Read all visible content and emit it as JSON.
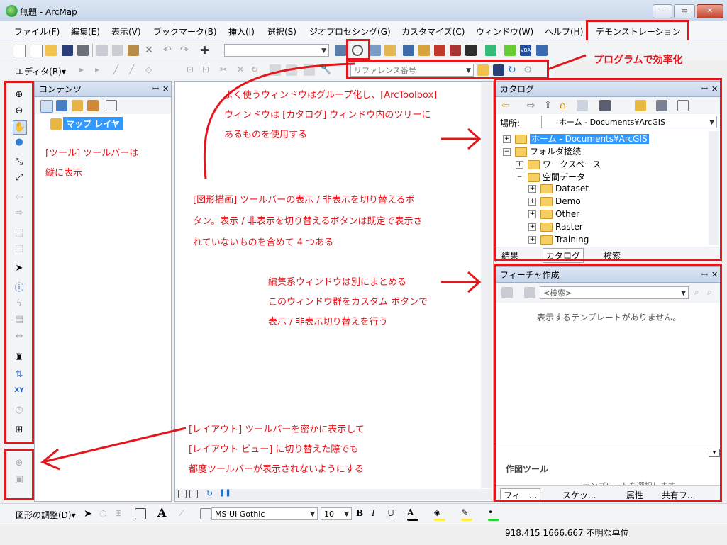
{
  "window": {
    "title": "無題 - ArcMap"
  },
  "menu": [
    "ファイル(F)",
    "編集(E)",
    "表示(V)",
    "ブックマーク(B)",
    "挿入(I)",
    "選択(S)",
    "ジオプロセシング(G)",
    "カスタマイズ(C)",
    "ウィンドウ(W)",
    "ヘルプ(H)",
    "デモンストレーション"
  ],
  "editor_toolbar": {
    "label": "エディタ(R)▾",
    "reference_combo": "リファレンス番号"
  },
  "toc": {
    "title": "コンテンツ",
    "layer": "マップ レイヤ"
  },
  "catalog": {
    "title": "カタログ",
    "location_label": "場所:",
    "location_value": "ホーム - Documents¥ArcGIS",
    "tree": {
      "home": "ホーム - Documents¥ArcGIS",
      "folder_connections": "フォルダ接続",
      "workspace": "ワークスペース",
      "spatial_data": "空間データ",
      "items": [
        "Dataset",
        "Demo",
        "Other",
        "Raster",
        "Training"
      ]
    },
    "tabs": [
      "結果",
      "カタログ",
      "検索"
    ]
  },
  "create_features": {
    "title": "フィーチャ作成",
    "search_placeholder": "<検索>",
    "empty_message": "表示するテンプレートがありません。",
    "construction_tools": "作図ツール",
    "hint_partial": "テンプレートを選択します",
    "tabs": [
      "フィー...",
      "スケッ...",
      "属性",
      "共有フ..."
    ]
  },
  "drawing_toolbar": {
    "label": "図形の調整(D)▾",
    "font": "MS UI Gothic",
    "size": "10",
    "bold": "B",
    "italic": "I",
    "underline": "U",
    "text_tool": "A"
  },
  "status": {
    "coords": "918.415  1666.667 不明な単位"
  },
  "annotations": {
    "efficiency": "プログラムで効率化",
    "window_group": [
      "よく使うウィンドウはグループ化し、[ArcToolbox]",
      "ウィンドウは [カタログ] ウィンドウ内のツリーに",
      "あるものを使用する"
    ],
    "tools_vertical": [
      "[ツール] ツールバーは",
      "縦に表示"
    ],
    "drawing_toggle": [
      "[図形描画] ツールバーの表示 / 非表示を切り替えるボ",
      "タン。表示 / 非表示を切り替えるボタンは既定で表示さ",
      "れていないものを含めて 4 つある"
    ],
    "edit_windows": [
      "編集系ウィンドウは別にまとめる",
      "このウィンドウ群をカスタム ボタンで",
      "表示 / 非表示切り替えを行う"
    ],
    "layout_toolbar": [
      "[レイアウト] ツールバーを密かに表示して",
      "[レイアウト ビュー] に切り替えた際でも",
      "都度ツールバーが表示されないようにする"
    ]
  },
  "colors": {
    "accent_red": "#e5151c",
    "selection": "#3399ff",
    "panel_head": "#c5d5ea"
  }
}
